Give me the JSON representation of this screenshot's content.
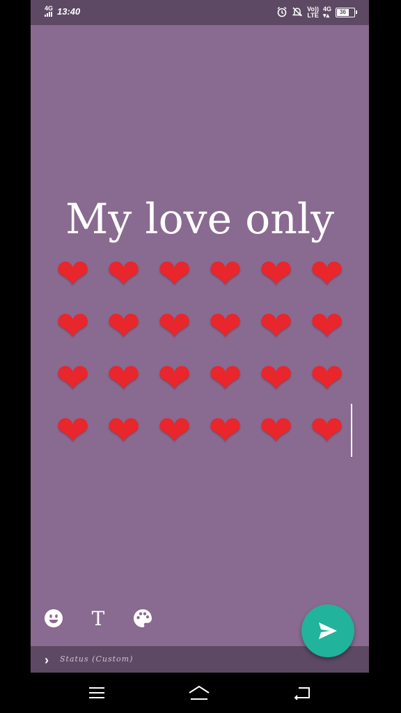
{
  "status_bar": {
    "network": "4G",
    "time": "13:40",
    "volte_top": "Vo))",
    "volte_bottom": "LTE",
    "network_right": "4G",
    "battery": "36",
    "icons": [
      "alarm-icon",
      "mute-icon",
      "volte-icon",
      "signal-icon",
      "battery-icon"
    ]
  },
  "status_text": {
    "title": "My love only",
    "hearts": [
      "❤️❤️❤️❤️❤️❤️",
      "❤️❤️❤️❤️❤️❤️",
      "❤️❤️❤️❤️❤️❤️",
      "❤️❤️❤️❤️❤️❤️"
    ],
    "background_color": "#896a90"
  },
  "toolbar": {
    "text_tool_label": "T",
    "icons": [
      "emoji-icon",
      "text-icon",
      "palette-icon"
    ]
  },
  "send_button": {
    "icon": "send-icon",
    "color": "#21b39b"
  },
  "audience": {
    "label": "Status (Custom)"
  },
  "nav_bar": {
    "icons": [
      "menu-icon",
      "home-icon",
      "back-icon"
    ]
  }
}
